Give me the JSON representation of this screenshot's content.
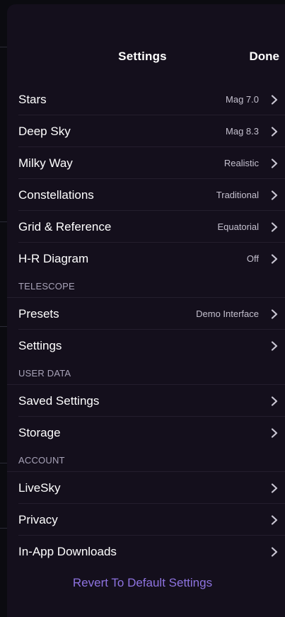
{
  "header": {
    "title": "Settings",
    "done_label": "Done"
  },
  "groups": [
    {
      "section": null,
      "items": [
        {
          "label": "Stars",
          "value": "Mag 7.0"
        },
        {
          "label": "Deep Sky",
          "value": "Mag 8.3"
        },
        {
          "label": "Milky Way",
          "value": "Realistic"
        },
        {
          "label": "Constellations",
          "value": "Traditional"
        },
        {
          "label": "Grid & Reference",
          "value": "Equatorial"
        },
        {
          "label": "H-R Diagram",
          "value": "Off"
        }
      ]
    },
    {
      "section": "TELESCOPE",
      "items": [
        {
          "label": "Presets",
          "value": "Demo Interface"
        },
        {
          "label": "Settings",
          "value": ""
        }
      ]
    },
    {
      "section": "USER DATA",
      "items": [
        {
          "label": "Saved Settings",
          "value": ""
        },
        {
          "label": "Storage",
          "value": ""
        }
      ]
    },
    {
      "section": "ACCOUNT",
      "items": [
        {
          "label": "LiveSky",
          "value": ""
        },
        {
          "label": "Privacy",
          "value": ""
        },
        {
          "label": "In-App Downloads",
          "value": ""
        }
      ]
    }
  ],
  "footer": {
    "revert_label": "Revert To Default Settings"
  },
  "colors": {
    "panel_background": "#140f1c",
    "accent": "#8e73e0",
    "secondary_text": "#c4c0ce"
  },
  "icons": {
    "disclosure": "chevron-right-icon"
  }
}
